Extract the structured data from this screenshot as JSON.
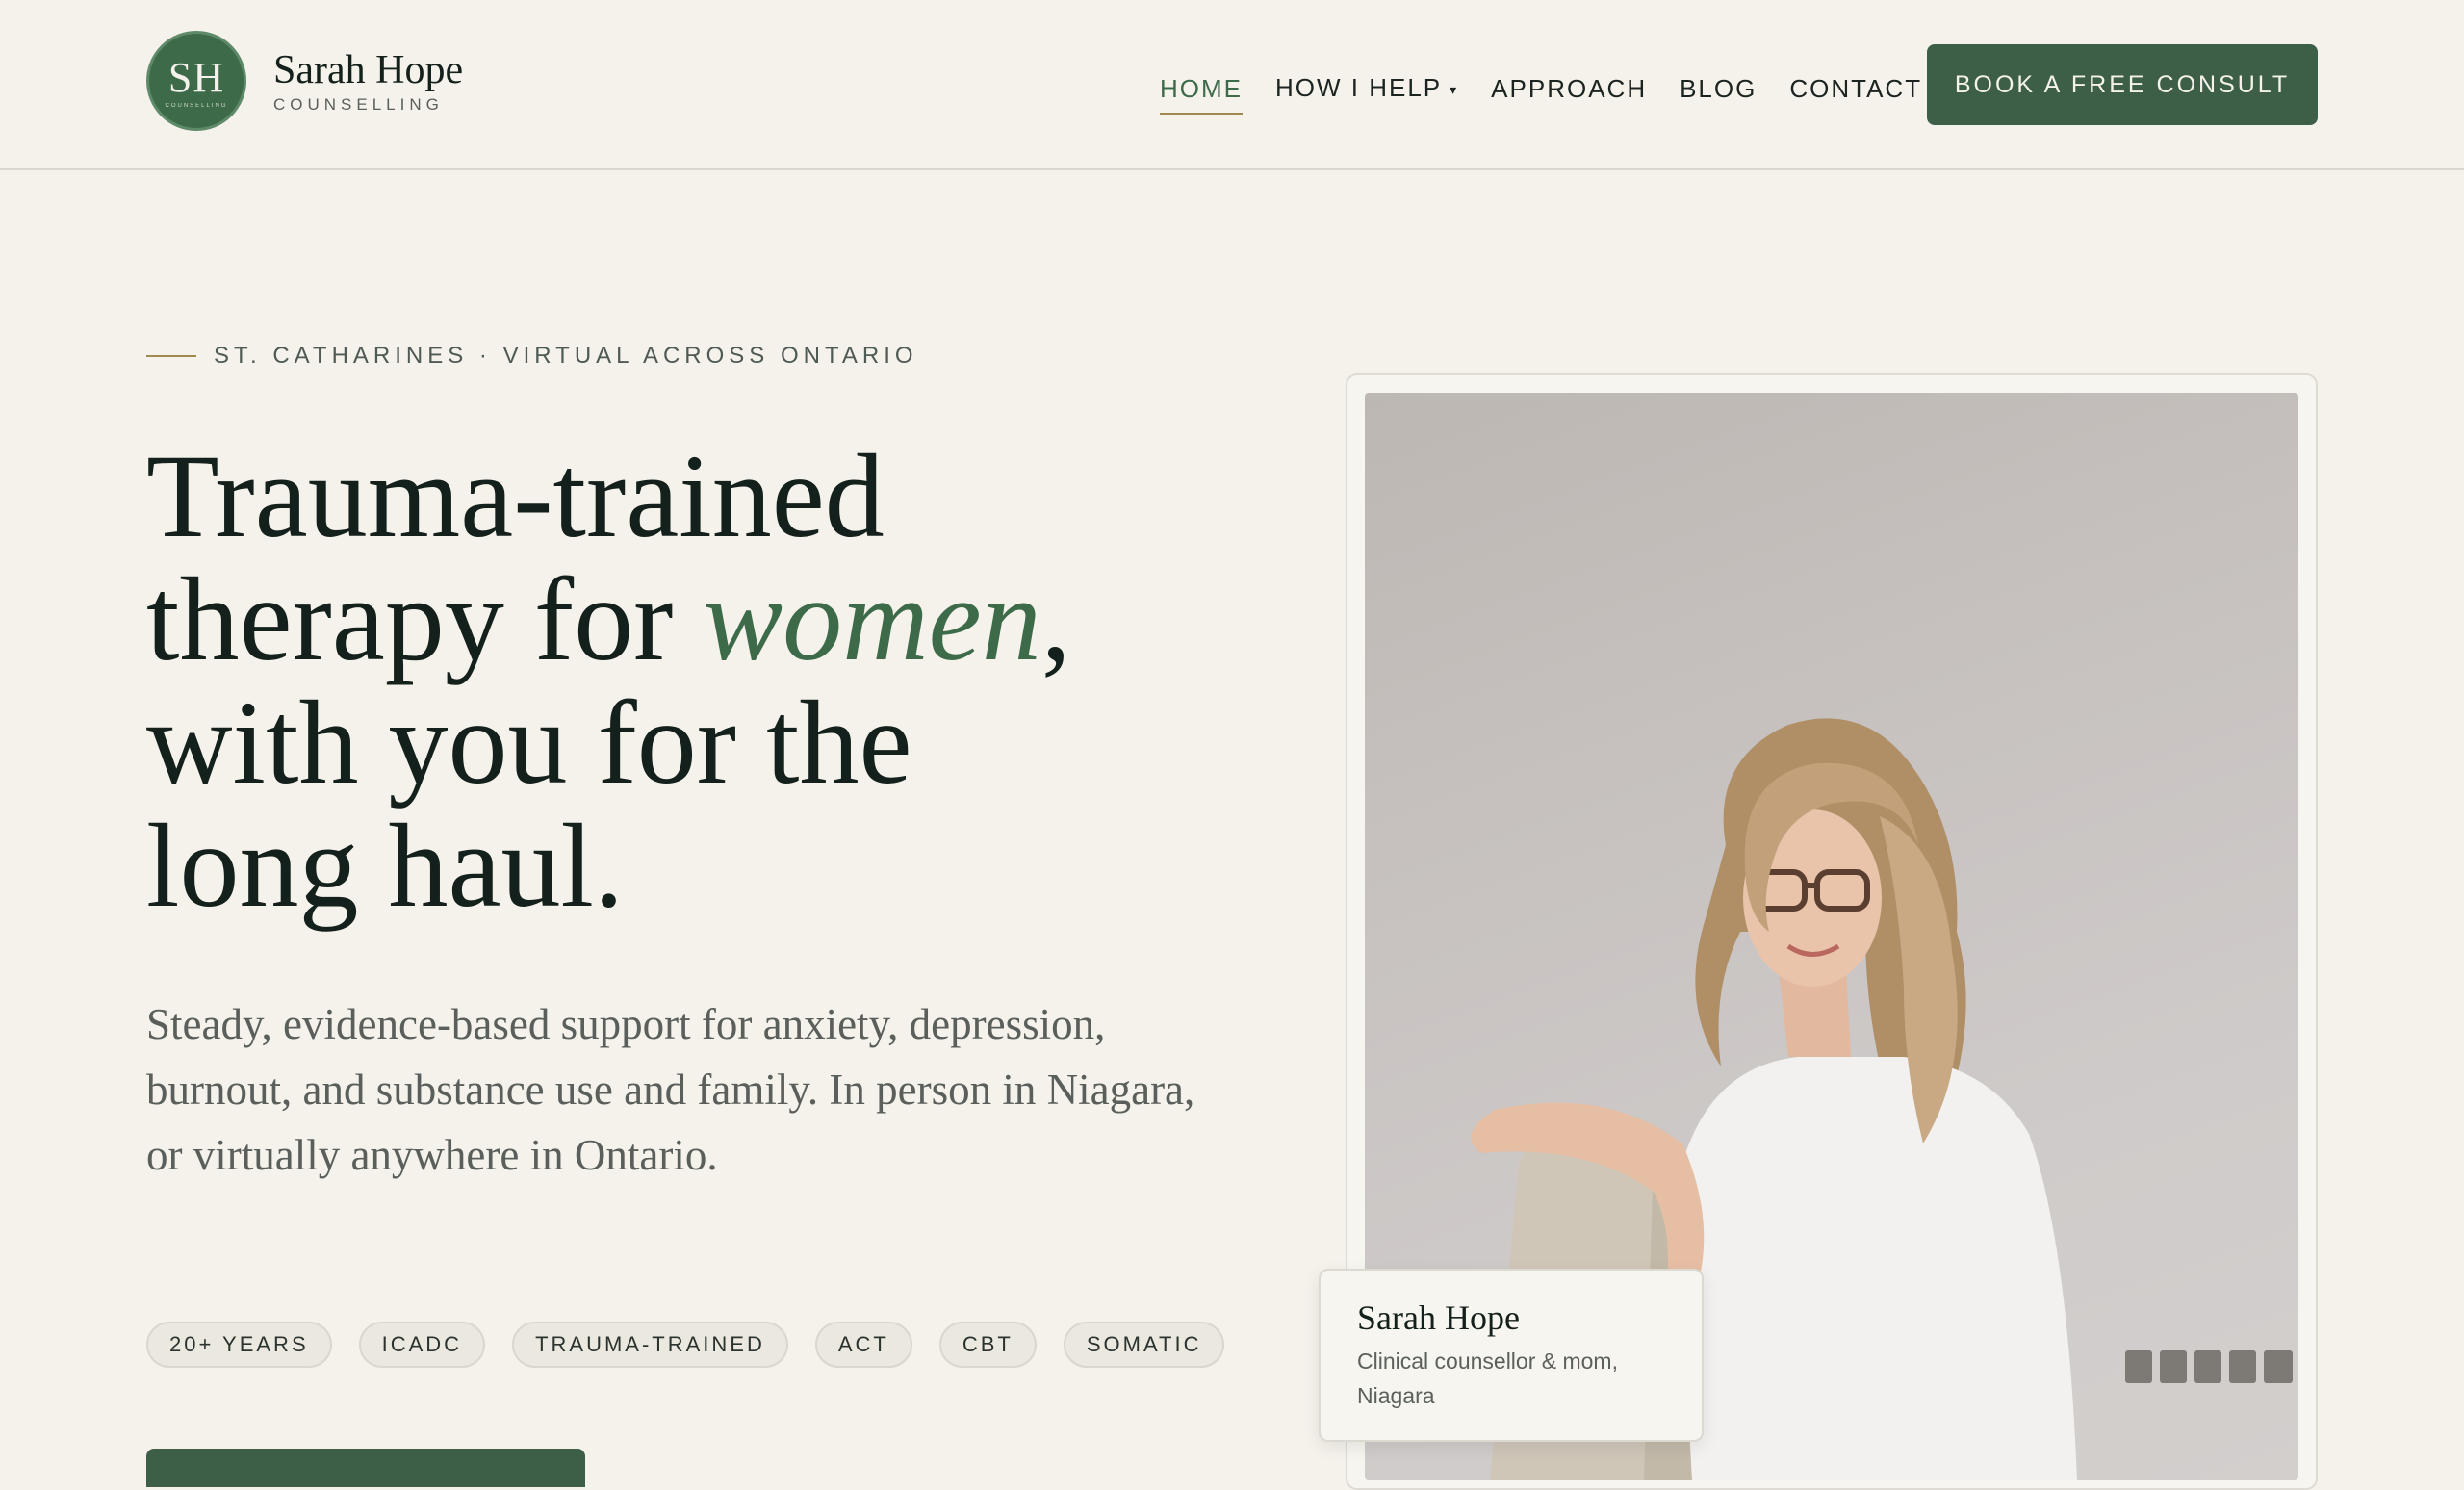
{
  "brand": {
    "monogram": "SH",
    "monogram_sub": "COUNSELLING",
    "name": "Sarah Hope",
    "tagline": "COUNSELLING"
  },
  "nav": {
    "items": [
      {
        "label": "HOME",
        "active": true
      },
      {
        "label": "HOW I HELP",
        "has_dropdown": true
      },
      {
        "label": "APPROACH"
      },
      {
        "label": "BLOG"
      },
      {
        "label": "CONTACT"
      }
    ],
    "dropdown_icon": "▾",
    "cta_label": "BOOK A FREE CONSULT"
  },
  "hero": {
    "eyebrow": "ST. CATHARINES · VIRTUAL ACROSS ONTARIO",
    "headline_line1": "Trauma-trained",
    "headline_line2_pre": "therapy for ",
    "headline_accent": "women",
    "headline_line2_post": ",",
    "headline_line3": "with you for the",
    "headline_line4": "long haul.",
    "lede": "Steady, evidence-based support for anxiety, depression, burnout, and substance use and family. In person in Niagara, or virtually anywhere in Ontario.",
    "credentials": [
      "20+ YEARS",
      "ICADC",
      "TRAUMA-TRAINED",
      "ACT",
      "CBT",
      "SOMATIC"
    ]
  },
  "portrait": {
    "caption_name": "Sarah Hope",
    "caption_role": "Clinical counsellor & mom, Niagara"
  },
  "colors": {
    "accent_green": "#3d6b4a",
    "button_green": "#3d5e47",
    "gold_rule": "#a08a4f",
    "background": "#f4f2eb"
  }
}
